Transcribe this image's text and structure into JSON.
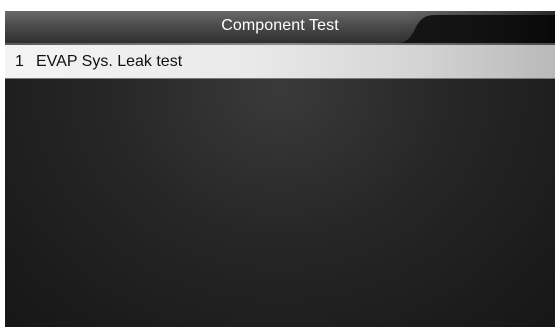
{
  "header": {
    "title": "Component Test"
  },
  "menu": {
    "items": [
      {
        "index": "1",
        "label": "EVAP Sys. Leak test",
        "selected": true
      }
    ]
  },
  "colors": {
    "background": "#262626",
    "title_bar": "#141414",
    "highlight": "#e9e9e9",
    "text_light": "#ffffff",
    "text_dark": "#111111"
  }
}
